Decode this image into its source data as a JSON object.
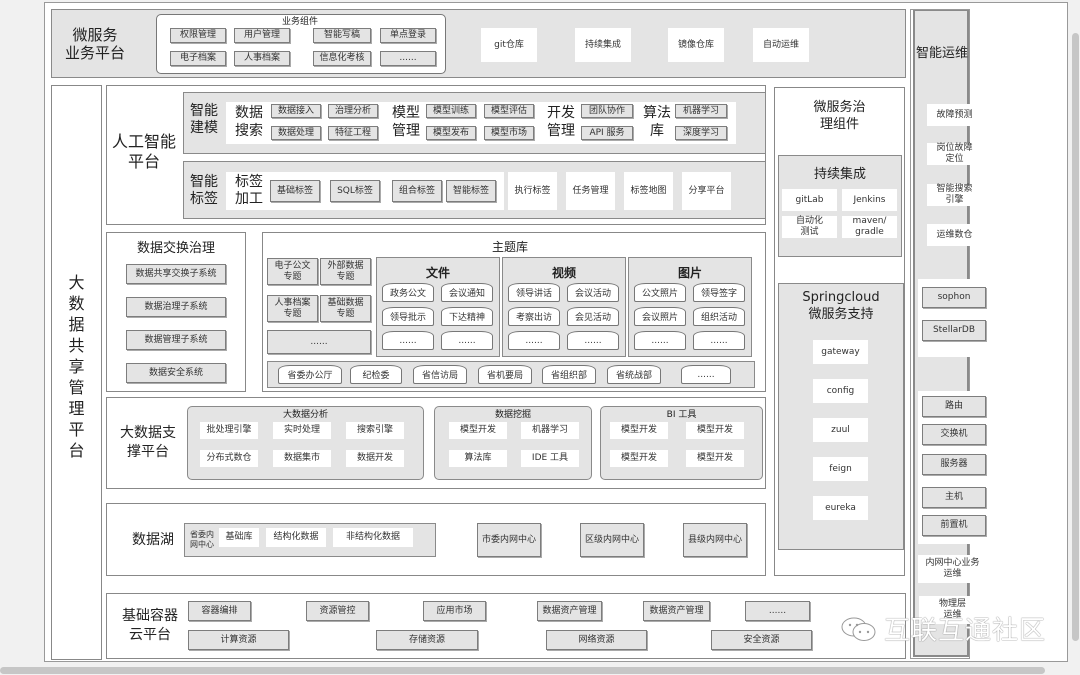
{
  "microservice_platform": {
    "title": "微服务\n业务平台",
    "components_title": "业务组件",
    "components": [
      "权限管理",
      "用户管理",
      "智能写稿",
      "单点登录",
      "电子档案",
      "人事档案",
      "信息化考核",
      "......"
    ],
    "tools": [
      "git仓库",
      "持续集成",
      "镜像仓库",
      "自动运维"
    ]
  },
  "big_data_platform": {
    "title": "大数据共享管理平台",
    "chars": [
      "大",
      "数",
      "据",
      "共",
      "享",
      "管",
      "理",
      "平",
      "台"
    ]
  },
  "ai_platform": {
    "title": "人工智能\n平台",
    "modeling": {
      "title": "智能\n建模",
      "groups": [
        {
          "title": "数据\n搜索",
          "items": [
            "数据接入",
            "治理分析",
            "数据处理",
            "特征工程"
          ]
        },
        {
          "title": "模型\n管理",
          "items": [
            "模型训练",
            "模型评估",
            "模型发布",
            "模型市场"
          ]
        },
        {
          "title": "开发\n管理",
          "items": [
            "团队协作",
            "API 服务"
          ]
        },
        {
          "title": "算法\n库",
          "items": [
            "机器学习",
            "深度学习"
          ]
        }
      ]
    },
    "labeling": {
      "title": "智能\n标签",
      "sub_title": "标签\n加工",
      "items": [
        "基础标签",
        "SQL标签",
        "组合标签",
        "智能标签"
      ],
      "extras": [
        "执行标签",
        "任务管理",
        "标签地图",
        "分享平台"
      ]
    }
  },
  "data_exchange": {
    "title": "数据交换治理",
    "items": [
      "数据共享交换子系统",
      "数据治理子系统",
      "数据管理子系统",
      "数据安全系统"
    ]
  },
  "topic_library": {
    "title": "主题库",
    "topics": [
      "电子公文\n专题",
      "外部数据\n专题",
      "人事档案\n专题",
      "基础数据\n专题",
      "......"
    ],
    "categories": [
      {
        "title": "文件",
        "items": [
          "政务公文",
          "会议通知",
          "领导批示",
          "下达精神",
          "......",
          "......"
        ]
      },
      {
        "title": "视频",
        "items": [
          "领导讲话",
          "会议活动",
          "考察出访",
          "会见活动",
          "......",
          "......"
        ]
      },
      {
        "title": "图片",
        "items": [
          "公文照片",
          "领导签字",
          "会议照片",
          "组织活动",
          "......",
          "......"
        ]
      }
    ],
    "departments": [
      "省委办公厅",
      "纪检委",
      "省信访局",
      "省机要局",
      "省组织部",
      "省统战部",
      "......"
    ]
  },
  "big_data_support": {
    "title": "大数据支\n撑平台",
    "groups": [
      {
        "title": "大数据分析",
        "items": [
          "批处理引擎",
          "实时处理",
          "搜索引擎",
          "分布式数仓",
          "数据集市",
          "数据开发"
        ]
      },
      {
        "title": "数据挖掘",
        "items": [
          "模型开发",
          "机器学习",
          "算法库",
          "IDE 工具"
        ]
      },
      {
        "title": "BI 工具",
        "items": [
          "模型开发",
          "模型开发",
          "模型开发",
          "模型开发"
        ]
      }
    ]
  },
  "data_lake": {
    "title": "数据湖",
    "province_center": "省委内\n网中心",
    "province_items": [
      "基础库",
      "结构化数据",
      "非结构化数据"
    ],
    "centers": [
      "市委内网中心",
      "区级内网中心",
      "县级内网中心"
    ]
  },
  "container_cloud": {
    "title": "基础容器\n云平台",
    "row1": [
      "容器编排",
      "资源管控",
      "应用市场",
      "数据资产管理",
      "数据资产管理",
      "......"
    ],
    "row2": [
      "计算资源",
      "存储资源",
      "网络资源",
      "安全资源"
    ]
  },
  "microservice_governance": {
    "title": "微服务治\n理组件",
    "ci": {
      "title": "持续集成",
      "items": [
        "gitLab",
        "Jenkins",
        "自动化\n测试",
        "maven/\ngradle"
      ]
    },
    "springcloud": {
      "title": "Springcloud\n微服务支持",
      "items": [
        "gateway",
        "config",
        "zuul",
        "feign",
        "eureka"
      ]
    }
  },
  "intelligent_ops": {
    "title": "智能运维",
    "items": [
      "故障预测",
      "岗位故障\n定位",
      "智能搜索\n引擎",
      "运维数仓"
    ],
    "db": [
      "sophon",
      "StellarDB"
    ],
    "hardware": [
      "路由",
      "交换机",
      "服务器",
      "主机",
      "前置机"
    ],
    "intranet_ops": "内网中心业务\n运维",
    "physical_ops": "物理层\n运维"
  },
  "watermark": "互联互通社区"
}
